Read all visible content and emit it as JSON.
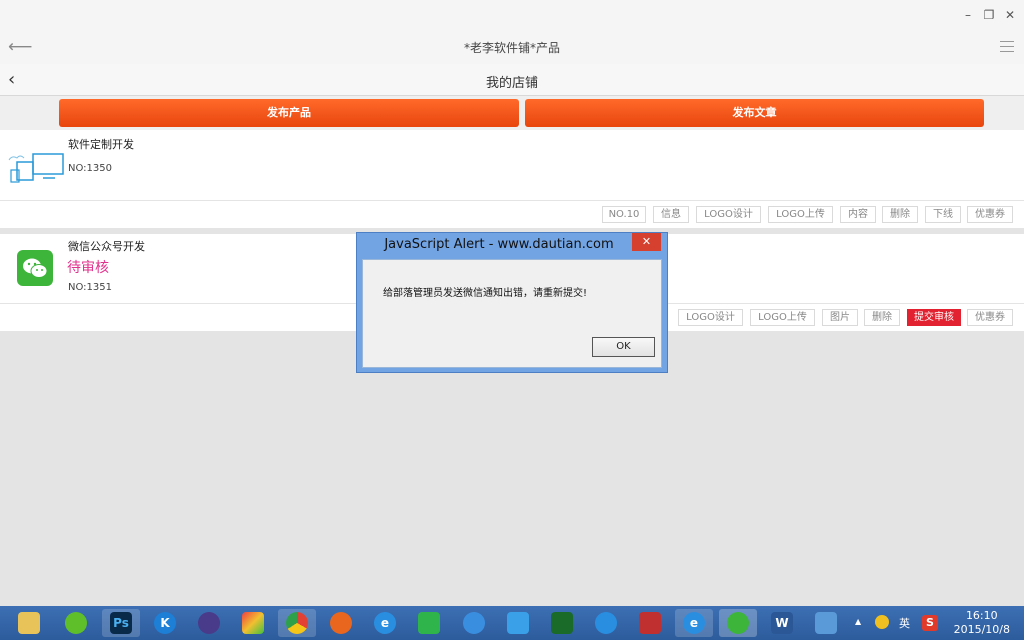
{
  "window": {
    "minimize": "–",
    "restore": "❐",
    "close": "✕"
  },
  "app": {
    "title": "*老李软件铺*产品",
    "back_icon": "arrow-left-icon",
    "menu_icon": "hamburger-icon"
  },
  "page": {
    "title": "我的店铺"
  },
  "actions": {
    "publish_product": "发布产品",
    "publish_article": "发布文章"
  },
  "products": [
    {
      "name": "软件定制开发",
      "no": "NO:1350",
      "status": "",
      "icon": "devices-icon",
      "buttons": [
        "NO.10",
        "信息",
        "LOGO设计",
        "LOGO上传",
        "内容",
        "删除",
        "下线",
        "优惠券"
      ]
    },
    {
      "name": "微信公众号开发",
      "no": "NO:1351",
      "status": "待审核",
      "icon": "wechat-icon",
      "buttons": [
        "LOGO设计",
        "LOGO上传",
        "图片",
        "删除",
        "提交审核",
        "优惠券"
      ]
    }
  ],
  "dialog": {
    "title": "JavaScript Alert - www.dautian.com",
    "close": "✕",
    "message": "给部落管理员发送微信通知出错，请重新提交!",
    "ok": "OK"
  },
  "taskbar": {
    "tray_ime": "英",
    "tray_s": "S",
    "tray_up": "▲",
    "time": "16:10",
    "date": "2015/10/8"
  },
  "colors": {
    "accent_orange": "#f05a1a",
    "status_pink": "#e0338f",
    "submit_red": "#e22230",
    "taskbar_blue": "#2d5c9c"
  }
}
